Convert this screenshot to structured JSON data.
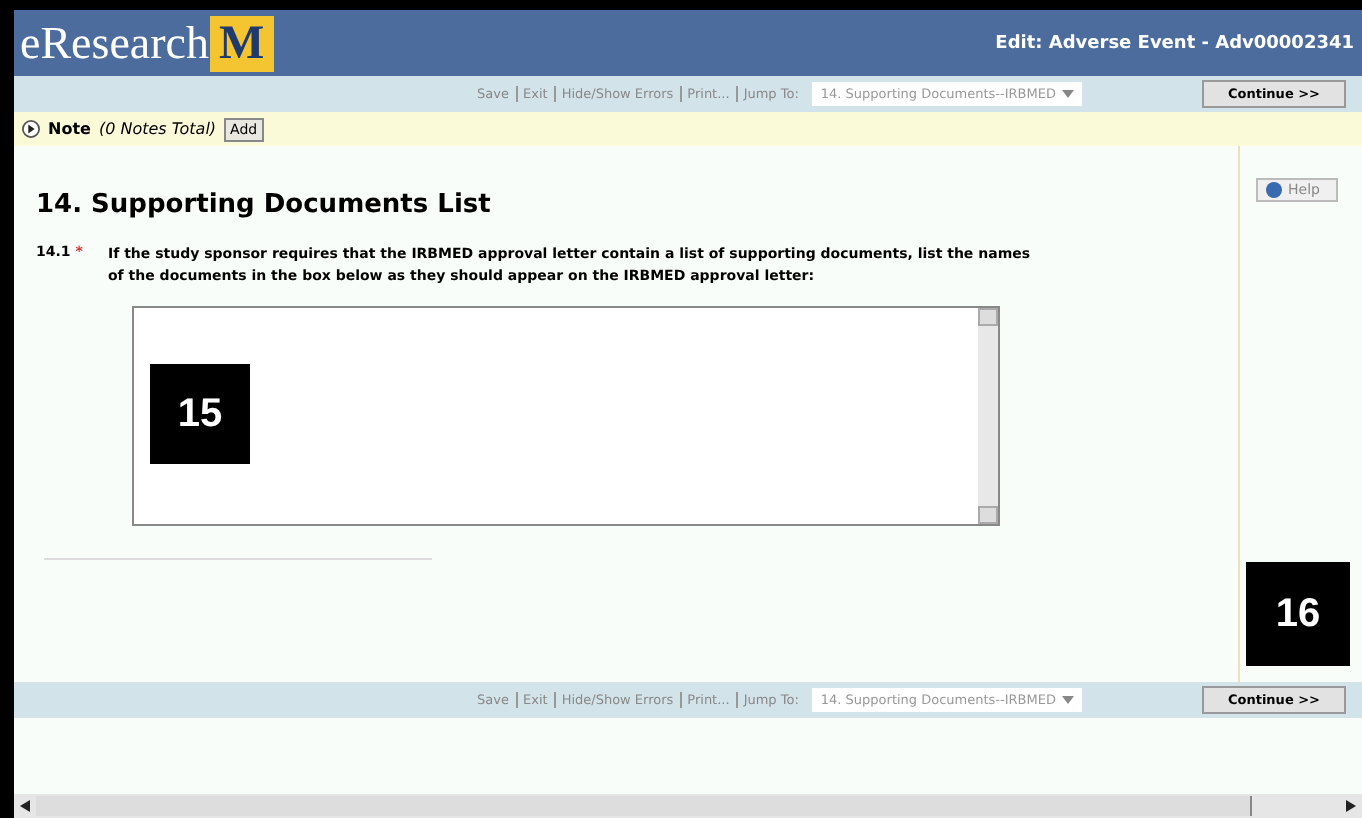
{
  "header": {
    "logo_text": "eResearch",
    "logo_mark": "M",
    "title": "Edit: Adverse Event - Adv00002341"
  },
  "toolbars": [
    {
      "links": [
        "Save",
        "Exit",
        "Hide/Show Errors",
        "Print..."
      ],
      "jump_label": "Jump To:",
      "jump_value": "14. Supporting Documents--IRBMED",
      "continue": "Continue >>"
    },
    {
      "links": [
        "Save",
        "Exit",
        "Hide/Show Errors",
        "Print..."
      ],
      "jump_label": "Jump To:",
      "jump_value": "14. Supporting Documents--IRBMED",
      "continue": "Continue >>"
    }
  ],
  "note_bar": {
    "expanded": false,
    "label": "Note",
    "count": "(0 Notes Total)",
    "add": "Add"
  },
  "section": {
    "heading": "14. Supporting Documents List",
    "question_number": "14.1",
    "required_mark": "*",
    "question": "If the study sponsor requires that the IRBMED approval letter contain a list of supporting documents, list the names of the documents in the box below as they should appear on the IRBMED approval letter:"
  },
  "help": "Help",
  "callouts": [
    "15",
    "16"
  ]
}
